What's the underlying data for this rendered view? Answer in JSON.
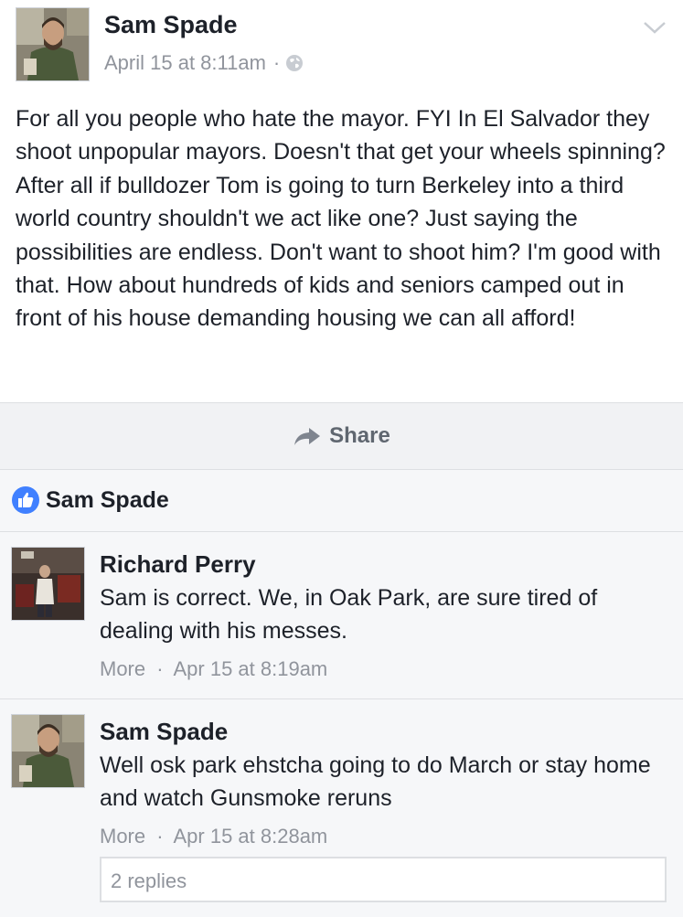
{
  "post": {
    "author": "Sam Spade",
    "timestamp": "April 15 at 8:11am",
    "separator": "·",
    "privacy_icon": "globe-icon",
    "menu_icon": "chevron-down-icon",
    "text": "For all you people who hate the mayor. FYI In El Salvador they shoot unpopular mayors. Doesn't that get your wheels spinning? After all if bulldozer Tom is going to turn Berkeley into a third world country shouldn't we act like one? Just saying the possibilities are endless. Don't want to shoot him? I'm good with that. How about hundreds of kids and seniors camped out in front of his house demanding housing we can all afford!"
  },
  "share": {
    "label": "Share",
    "icon": "share-arrow-icon"
  },
  "likes": {
    "icon": "thumbs-up-icon",
    "name": "Sam Spade"
  },
  "comments": [
    {
      "author": "Richard Perry",
      "text": "Sam is correct. We, in Oak Park, are sure tired of dealing with his messes.",
      "more": "More",
      "separator": "·",
      "time": "Apr 15 at 8:19am"
    },
    {
      "author": "Sam Spade",
      "text": "Well osk park ehstcha going to do March or stay home and watch Gunsmoke reruns",
      "more": "More",
      "separator": "·",
      "time": "Apr 15 at 8:28am",
      "replies": "2 replies"
    }
  ],
  "colors": {
    "text": "#1d2129",
    "meta": "#90949c",
    "like_blue": "#4080ff",
    "divider": "#dddfe2"
  }
}
